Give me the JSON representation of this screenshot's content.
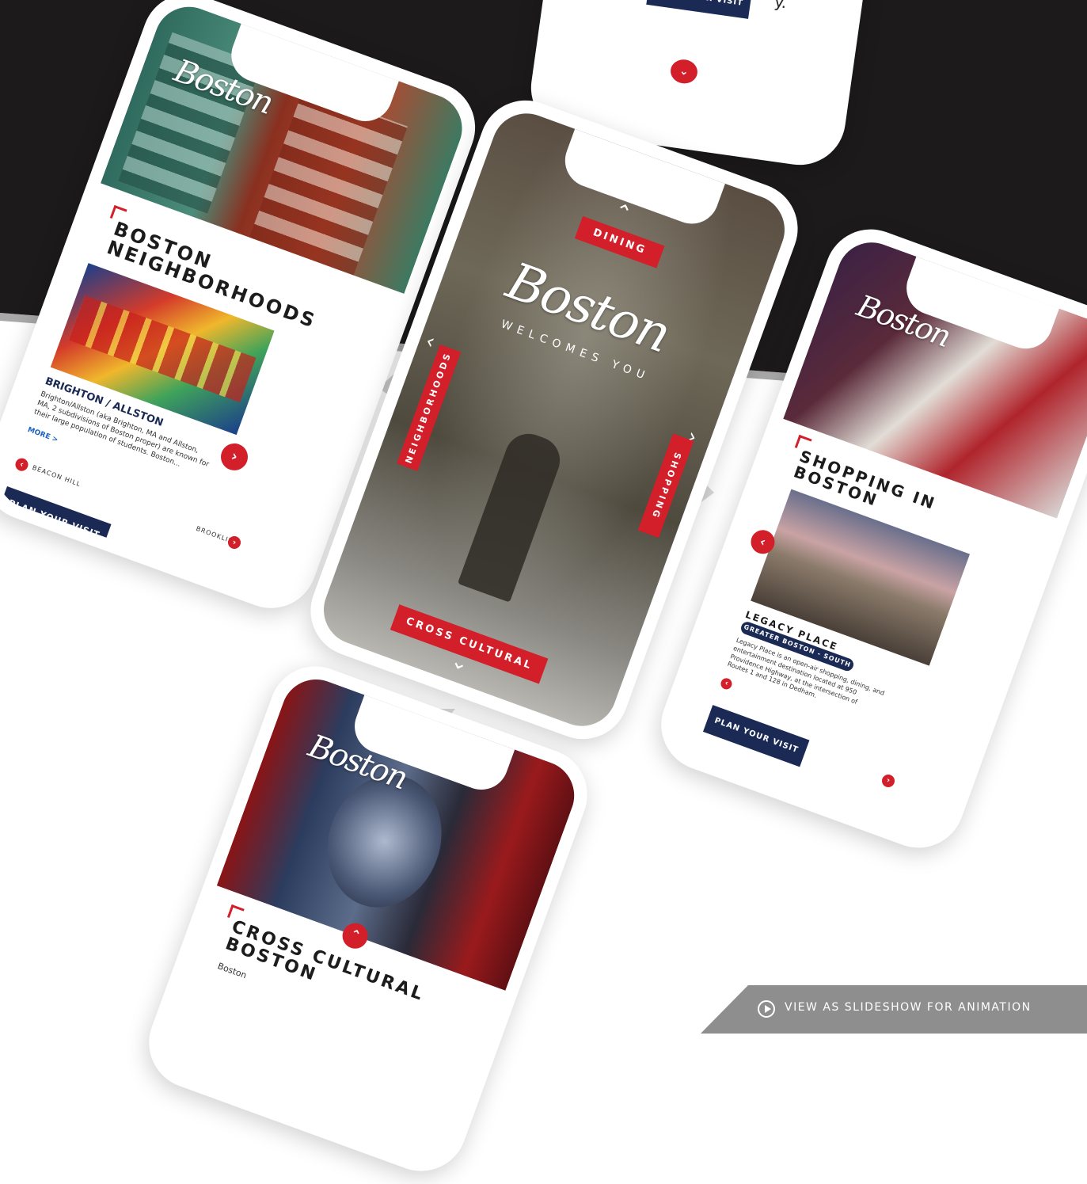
{
  "colors": {
    "accent": "#d21f2a",
    "navy": "#1a2a55",
    "dark_bg": "#1c1a1b",
    "arrow": "#d0d0d0"
  },
  "top_phone": {
    "button": "PLAN YOUR VISIT",
    "text_fragment": "y.",
    "chevron": "chevron-down-icon"
  },
  "center_phone": {
    "logo": "Boston",
    "tagline": "WELCOMES YOU",
    "tag_top": "DINING",
    "tag_left": "NEIGHBORHOODS",
    "tag_right": "SHOPPING",
    "tag_bottom": "CROSS CULTURAL"
  },
  "left_phone": {
    "logo": "Boston",
    "title_line1": "BOSTON",
    "title_line2": "NEIGHBORHOODS",
    "item_title": "BRIGHTON / ALLSTON",
    "item_desc": "Brighton/Allston (aka Brighton, MA and Allston, MA, 2 subdivisions of Boston proper) are known for their large population of students. Boston...",
    "more": "MORE >",
    "prev_label": "BEACON HILL",
    "next_label": "BROOKLINE",
    "cta": "PLAN YOUR VISIT"
  },
  "right_phone": {
    "logo": "Boston",
    "title_line1": "SHOPPING IN",
    "title_line2": "BOSTON",
    "item_title": "LEGACY PLACE",
    "item_badge": "GREATER BOSTON - SOUTH",
    "item_desc": "Legacy Place is an open-air shopping, dining, and entertainment destination located at 950 Providence Highway, at the intersection of Routes 1 and 128 in Dedham.",
    "cta": "PLAN YOUR VISIT"
  },
  "bottom_phone": {
    "logo": "Boston",
    "title_line1": "CROSS CULTURAL",
    "title_line2": "BOSTON",
    "text_fragment": "Boston"
  },
  "slideshow": {
    "label": "VIEW AS SLIDESHOW FOR ANIMATION",
    "icon": "play-circle-icon"
  }
}
